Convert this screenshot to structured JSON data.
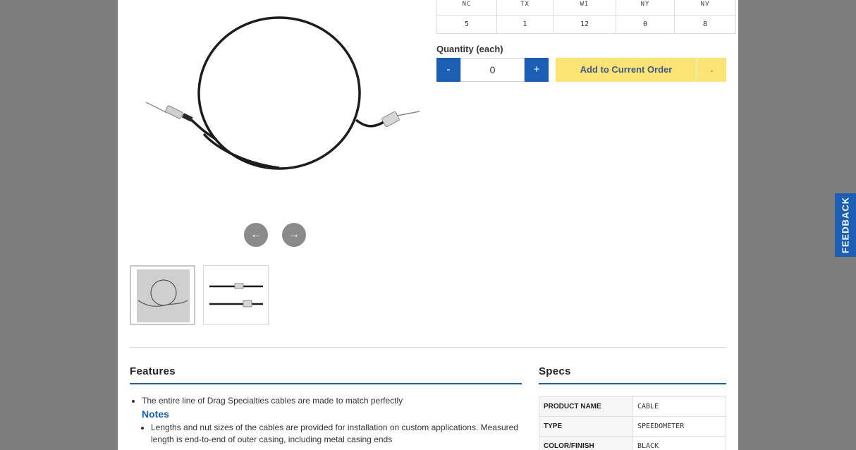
{
  "stock": {
    "states": [
      "NC",
      "TX",
      "WI",
      "NY",
      "NV"
    ],
    "counts": [
      "5",
      "1",
      "12",
      "0",
      "8"
    ]
  },
  "quantity": {
    "label": "Quantity (each)",
    "value": "0",
    "minus_label": "-",
    "plus_label": "+"
  },
  "order": {
    "add_label": "Add to Current Order"
  },
  "gallery": {
    "prev_arrow": "←",
    "next_arrow": "→"
  },
  "features": {
    "title": "Features",
    "bullet": "The entire line of Drag Specialties cables are made to match perfectly",
    "notes_title": "Notes",
    "notes_text": "Lengths and nut sizes of the cables are provided for installation on custom applications. Measured length is end-to-end of outer casing, including metal casing ends"
  },
  "specs": {
    "title": "Specs",
    "rows": [
      {
        "key": "PRODUCT NAME",
        "value": "CABLE"
      },
      {
        "key": "TYPE",
        "value": "SPEEDOMETER"
      },
      {
        "key": "COLOR/FINISH",
        "value": "BLACK"
      }
    ]
  },
  "feedback": {
    "label": "FEEDBACK"
  },
  "colors": {
    "accent": "#1a5fb4",
    "add_button": "#fce474",
    "overlay": "#7d7d7d"
  }
}
